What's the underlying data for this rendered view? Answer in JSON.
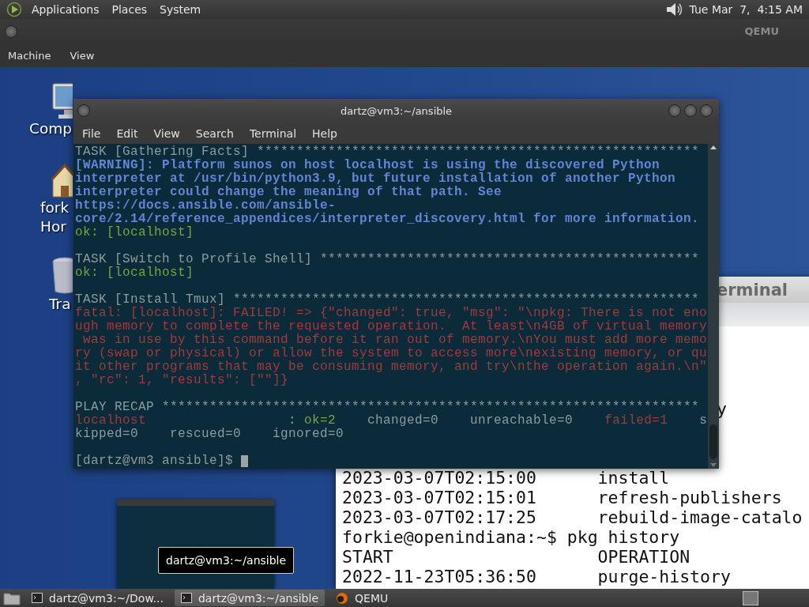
{
  "top_panel": {
    "menus": [
      "Applications",
      "Places",
      "System"
    ],
    "clock": "Tue Mar  7,  4:15 AM"
  },
  "qemu_window": {
    "title": "QEMU",
    "menus": [
      "Machine",
      "View"
    ]
  },
  "desktop_icons": [
    {
      "kind": "computer",
      "label_lines": [
        "Comp"
      ]
    },
    {
      "kind": "home",
      "label_lines": [
        "fork",
        "Hor"
      ]
    },
    {
      "kind": "trash",
      "label_lines": [
        "Tra"
      ]
    }
  ],
  "background_terminal": {
    "title": "erminal",
    "fragments": [
      "y"
    ],
    "lines": [
      "2023-03-07T02:15:00      install",
      "2023-03-07T02:15:01      refresh-publishers",
      "2023-03-07T02:17:25      rebuild-image-catalo",
      "forkie@openindiana:~$ pkg history",
      "START                    OPERATION",
      "2022-11-23T05:36:50      purge-history"
    ]
  },
  "terminal": {
    "title": "dartz@vm3:~/ansible",
    "menus": [
      "File",
      "Edit",
      "View",
      "Search",
      "Terminal",
      "Help"
    ],
    "blocks": [
      [
        [
          {
            "kind": "task",
            "text": "TASK [Gathering Facts] ********************************************************"
          }
        ],
        [
          {
            "kind": "warning",
            "text": "[WARNING]: Platform sunos on host localhost is using the discovered Python"
          }
        ],
        [
          {
            "kind": "warning",
            "text": "interpreter at /usr/bin/python3.9, but future installation of another Python"
          }
        ],
        [
          {
            "kind": "warning",
            "text": "interpreter could change the meaning of that path. See"
          }
        ],
        [
          {
            "kind": "warning",
            "text": "https://docs.ansible.com/ansible-"
          }
        ],
        [
          {
            "kind": "warning",
            "text": "core/2.14/reference_appendices/interpreter_discovery.html for more information."
          }
        ],
        [
          {
            "kind": "ok",
            "text": "ok: [localhost]"
          }
        ]
      ],
      [
        [
          {
            "kind": "task",
            "text": "TASK [Switch to Profile Shell] ************************************************"
          }
        ],
        [
          {
            "kind": "ok",
            "text": "ok: [localhost]"
          }
        ]
      ],
      [
        [
          {
            "kind": "task",
            "text": "TASK [Install Tmux] ***********************************************************"
          }
        ],
        [
          {
            "kind": "fatal",
            "text": "fatal: [localhost]: FAILED! => {\"changed\": true, \"msg\": \"\\npkg: There is not eno"
          }
        ],
        [
          {
            "kind": "fatal",
            "text": "ugh memory to complete the requested operation.  At least\\n4GB of virtual memory"
          }
        ],
        [
          {
            "kind": "fatal",
            "text": " was in use by this command before it ran out of memory.\\nYou must add more memo"
          }
        ],
        [
          {
            "kind": "fatal",
            "text": "ry (swap or physical) or allow the system to access more\\nexisting memory, or qu"
          }
        ],
        [
          {
            "kind": "fatal",
            "text": "it other programs that may be consuming memory, and try\\nthe operation again.\\n\""
          }
        ],
        [
          {
            "kind": "fatal",
            "text": ", \"rc\": 1, \"results\": [\"\"]}"
          }
        ]
      ],
      [
        [
          {
            "kind": "task",
            "text": "PLAY RECAP ********************************************************************"
          }
        ],
        [
          {
            "kind": "fatal",
            "text": "localhost"
          },
          {
            "kind": "plain",
            "text": "                  : "
          },
          {
            "kind": "ok",
            "text": "ok=2"
          },
          {
            "kind": "plain",
            "text": "    changed=0    unreachable=0    "
          },
          {
            "kind": "fatal",
            "text": "failed=1"
          },
          {
            "kind": "plain",
            "text": "    s"
          }
        ],
        [
          {
            "kind": "plain",
            "text": "kipped=0    rescued=0    ignored=0"
          }
        ]
      ],
      [
        [
          {
            "kind": "plain",
            "text": "[dartz@vm3 ansible]$ "
          },
          {
            "kind": "cursor"
          }
        ]
      ]
    ]
  },
  "tooltip": "dartz@vm3:~/ansible",
  "taskbar": {
    "items": [
      {
        "kind": "terminal",
        "label": "dartz@vm3:~/Dow...",
        "selected": false
      },
      {
        "kind": "terminal",
        "label": "dartz@vm3:~/ansible",
        "selected": true
      },
      {
        "kind": "qemu",
        "label": "QEMU",
        "selected": false
      }
    ]
  }
}
